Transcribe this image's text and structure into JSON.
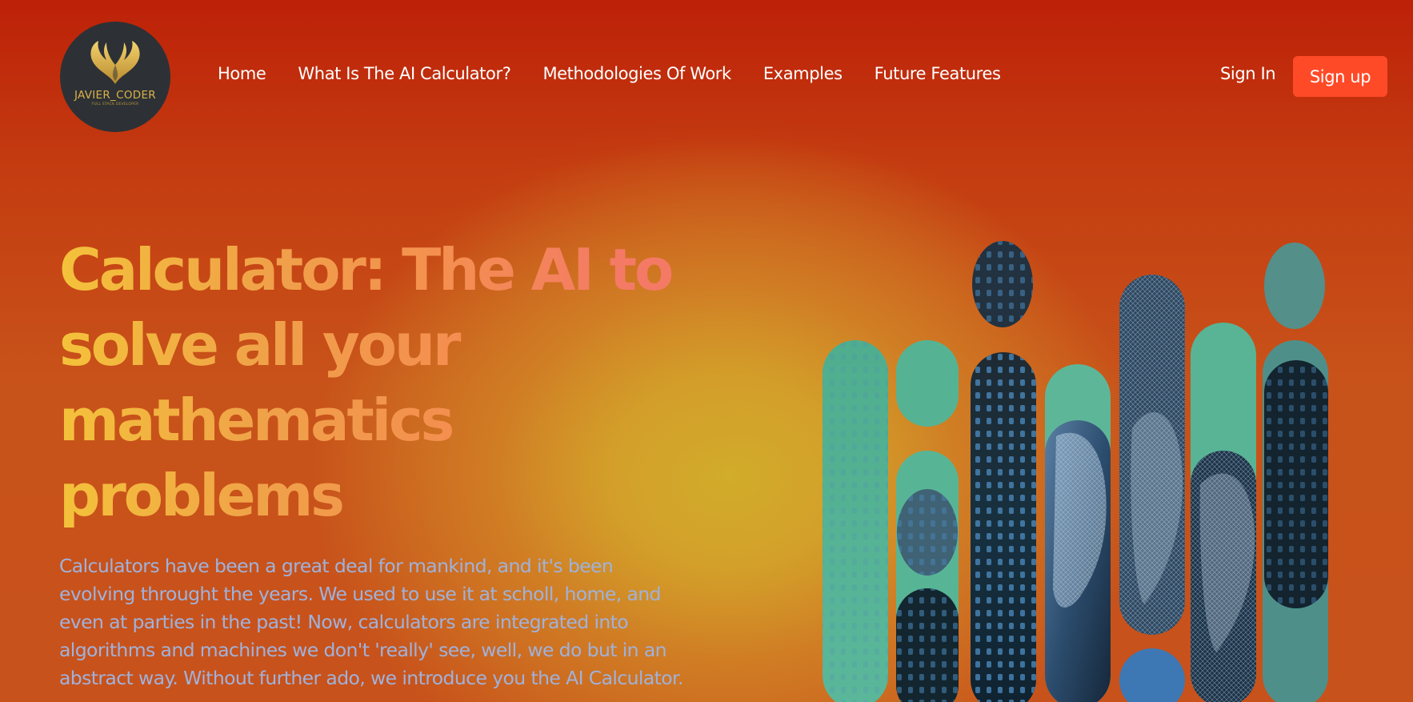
{
  "logo": {
    "icon": "phoenix-wings-icon",
    "name": "JAVIER_CODER",
    "tagline": "FULL STACK DEVELOPER"
  },
  "nav": {
    "items": [
      {
        "label": "Home"
      },
      {
        "label": "What Is The AI Calculator?"
      },
      {
        "label": "Methodologies Of Work"
      },
      {
        "label": "Examples"
      },
      {
        "label": "Future Features"
      }
    ]
  },
  "auth": {
    "sign_in": "Sign In",
    "sign_up": "Sign up"
  },
  "hero": {
    "title": "Calculator: The AI to solve all your mathematics problems",
    "description": "Calculators have been a great deal for mankind, and it's been evolving throught the years. We used to use it at scholl, home, and even at parties in the past! Now, calculators are integrated into algorithms and machines we don't 'really' see, well, we do but in an abstract way. Without further ado, we introduce you the AI Calculator."
  },
  "colors": {
    "background_top": "#bd2108",
    "background_glow": "#d2c02c",
    "sign_up_bg": "#ff4a27",
    "title_start": "#f4c23a",
    "title_end": "#f47a66",
    "description": "#9fb2dc"
  },
  "art": {
    "icon": "ai-robot-face-pills-illustration"
  }
}
